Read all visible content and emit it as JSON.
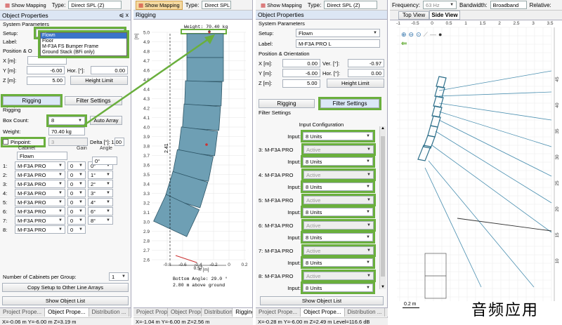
{
  "panel1": {
    "toolbar": {
      "show_mapping": "Show Mapping",
      "type_label": "Type:",
      "type_value": "Direct SPL (Z)"
    },
    "title": "Object Properties",
    "pin": "⩿ x",
    "system_parameters": "System Parameters",
    "setup_label": "Setup:",
    "setup_value": "Flown",
    "setup_options": [
      "Flown",
      "Floor",
      "M-F3A FS Bumper Frame",
      "Ground Stack (BFi only)"
    ],
    "label_label": "Label:",
    "position_label": "Position & O",
    "x_label": "X [m]:",
    "y_label": "Y [m]:",
    "y_value": "-6.00",
    "z_label": "Z [m]:",
    "z_value": "5.00",
    "hor_label": "Hor. [°]:",
    "hor_value": "0.00",
    "height_limit": "Height Limit",
    "tab_rigging": "Rigging",
    "tab_filter": "Filter Settings",
    "rigging_title": "Rigging",
    "box_count_label": "Box Count:",
    "box_count_value": "8",
    "auto_array": "Auto Array",
    "weight_label": "Weight:",
    "weight_value": "70.40 kg",
    "pinpoint_label": "Pinpoint:",
    "pinpoint_value": "3",
    "delta_label": "Delta [°]:",
    "delta_value": "1.00",
    "col_cabinet": "Cabinet",
    "col_gain": "Gain",
    "col_angle": "Angle",
    "flown_row": "Flown",
    "first_angle": "0°",
    "rows": [
      {
        "n": "1:",
        "cab": "M-F3A PRO",
        "gain": "0",
        "angle": "0°"
      },
      {
        "n": "2:",
        "cab": "M-F3A PRO",
        "gain": "0",
        "angle": "1°"
      },
      {
        "n": "3:",
        "cab": "M-F3A PRO",
        "gain": "0",
        "angle": "2°"
      },
      {
        "n": "4:",
        "cab": "M-F3A PRO",
        "gain": "0",
        "angle": "3°"
      },
      {
        "n": "5:",
        "cab": "M-F3A PRO",
        "gain": "0",
        "angle": "4°"
      },
      {
        "n": "6:",
        "cab": "M-F3A PRO",
        "gain": "0",
        "angle": "6°"
      },
      {
        "n": "7:",
        "cab": "M-F3A PRO",
        "gain": "0",
        "angle": "8°"
      },
      {
        "n": "8:",
        "cab": "M-F3A PRO",
        "gain": "0",
        "angle": ""
      }
    ],
    "cabinets_per_group_label": "Number of Cabinets per Group:",
    "cabinets_per_group_value": "1",
    "copy_setup": "Copy Setup to Other Line Arrays",
    "show_object_list": "Show Object List",
    "bottom_tabs": [
      "Project Prope...",
      "Object Prope...",
      "Distribution ..."
    ],
    "status": "X=-0.06 m Y=-6.00 m Z=3.19 m"
  },
  "panel2": {
    "toolbar": {
      "show_mapping": "Show Mapping",
      "type_label": "Type:",
      "type_value": "Direct SPL (Z)"
    },
    "title": "Rigging",
    "weight_caption": "Weight: 70.40 kg",
    "y_ticks": [
      "5.0",
      "4.9",
      "4.8",
      "4.7",
      "4.6",
      "4.5",
      "4.4",
      "4.3",
      "4.2",
      "4.1",
      "4.0",
      "3.9",
      "3.8",
      "3.7",
      "3.6",
      "3.5",
      "3.4",
      "3.3",
      "3.2",
      "3.1",
      "3.0",
      "2.9",
      "2.8",
      "2.7",
      "2.6"
    ],
    "y_unit": "[m]",
    "x_ticks": [
      "-0.8",
      "-0.6",
      "-0.4",
      "-0.2",
      "0",
      "0.2"
    ],
    "x_unit": "X [m]",
    "height_dim": "2.41",
    "width_dim": "0.57",
    "bottom_angle": "Bottom Angle: 29.0 °",
    "above_ground": "2.80 m above ground",
    "bottom_tabs": [
      "Project Prope...",
      "Object Prope...",
      "Distribution ...",
      "Rigging"
    ],
    "status": "X=-1.04 m Y=-6.00 m Z=2.56 m"
  },
  "panel3": {
    "toolbar": {
      "show_mapping": "Show Mapping",
      "type_label": "Type:",
      "type_value": "Direct SPL (Z)"
    },
    "title": "Object Properties",
    "system_parameters": "System Parameters",
    "setup_label": "Setup:",
    "setup_value": "Flown",
    "label_label": "Label:",
    "label_value": "M-F3A PRO L",
    "position_title": "Position & Orientation",
    "x_label": "X [m]:",
    "x_value": "0.00",
    "y_label": "Y [m]:",
    "y_value": "-6.00",
    "z_label": "Z [m]:",
    "z_value": "5.00",
    "ver_label": "Ver. [°]:",
    "ver_value": "-0.97",
    "hor_label": "Hor. [°]:",
    "hor_value": "0.00",
    "height_limit": "Height Limit",
    "tab_rigging": "Rigging",
    "tab_filter": "Filter Settings",
    "filter_title": "Filter Settings",
    "input_config": "Input Configuration",
    "input_label": "Input:",
    "input_top": "8 Units",
    "groups": [
      {
        "n": "3:",
        "cab": "M-F3A PRO",
        "state": "Active",
        "input": "8 Units"
      },
      {
        "n": "4:",
        "cab": "M-F3A PRO",
        "state": "Active",
        "input": "8 Units"
      },
      {
        "n": "5:",
        "cab": "M-F3A PRO",
        "state": "Active",
        "input": "8 Units"
      },
      {
        "n": "6:",
        "cab": "M-F3A PRO",
        "state": "Active",
        "input": "8 Units"
      },
      {
        "n": "7:",
        "cab": "M-F3A PRO",
        "state": "Active",
        "input": "8 Units"
      },
      {
        "n": "8:",
        "cab": "M-F3A PRO",
        "state": "Active",
        "input": "8 Units"
      }
    ],
    "show_object_list": "Show Object List",
    "bottom_tabs": [
      "Project Prope...",
      "Object Prope...",
      "Distribution ..."
    ],
    "status": "X=-0.28 m Y=-6.00 m Z=2.49 m Level=116.6 dB"
  },
  "panel4": {
    "toolbar": {
      "frequency_label": "Frequency:",
      "frequency_value": "63 Hz",
      "bandwidth_label": "Bandwidth:",
      "bandwidth_value": "Broadband",
      "relative_label": "Relative:"
    },
    "tab_top": "Top View",
    "tab_side": "Side View",
    "x_ticks": [
      "-1",
      "-0.5",
      "0",
      "0.5",
      "1",
      "1.5",
      "2",
      "2.5",
      "3",
      "3.5"
    ],
    "y_ticks": [
      "45",
      "40",
      "35",
      "30",
      "25",
      "20",
      "15",
      "10"
    ],
    "scale": "0.2 m"
  },
  "watermark": "音频应用",
  "colors": {
    "highlight": "#6aaf3d",
    "cabinet": "#6e9fb4",
    "ray": "#4a8fb0",
    "panel_title": "#dce6f4"
  }
}
